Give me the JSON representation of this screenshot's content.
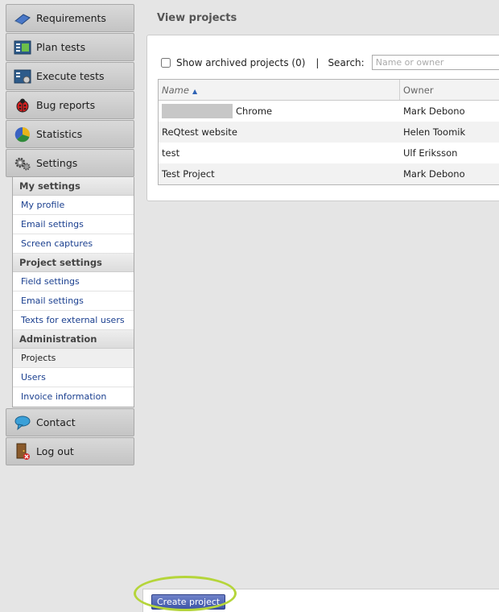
{
  "sidebar": {
    "nav": [
      {
        "label": "Requirements",
        "icon": "requirements-book-icon"
      },
      {
        "label": "Plan tests",
        "icon": "plan-tests-icon"
      },
      {
        "label": "Execute tests",
        "icon": "execute-tests-icon"
      },
      {
        "label": "Bug reports",
        "icon": "ladybug-icon"
      },
      {
        "label": "Statistics",
        "icon": "pie-chart-icon"
      },
      {
        "label": "Settings",
        "icon": "gears-icon"
      },
      {
        "label": "Contact",
        "icon": "speech-bubble-icon"
      },
      {
        "label": "Log out",
        "icon": "door-exit-icon"
      }
    ],
    "settings": {
      "my_settings": {
        "heading": "My settings",
        "items": [
          "My profile",
          "Email settings",
          "Screen captures"
        ]
      },
      "project_settings": {
        "heading": "Project settings",
        "items": [
          "Field settings",
          "Email settings",
          "Texts for external users"
        ]
      },
      "administration": {
        "heading": "Administration",
        "items": [
          "Projects",
          "Users",
          "Invoice information"
        ]
      }
    }
  },
  "main": {
    "title": "View projects",
    "filter": {
      "archived_label": "Show archived projects (0)",
      "separator": "|",
      "search_label": "Search:",
      "search_placeholder": "Name or owner",
      "search_value": ""
    },
    "table": {
      "columns": [
        "Name",
        "Owner"
      ],
      "rows": [
        {
          "name": "Chrome",
          "owner": "Mark Debono",
          "redacted_prefix": true
        },
        {
          "name": "ReQtest website",
          "owner": "Helen Toomik"
        },
        {
          "name": "test",
          "owner": "Ulf Eriksson"
        },
        {
          "name": "Test Project",
          "owner": "Mark Debono"
        }
      ]
    }
  },
  "footer": {
    "create_label": "Create project"
  },
  "colors": {
    "link": "#1a3f8f",
    "button": "#3e55a8",
    "highlight": "#b5d53a"
  }
}
